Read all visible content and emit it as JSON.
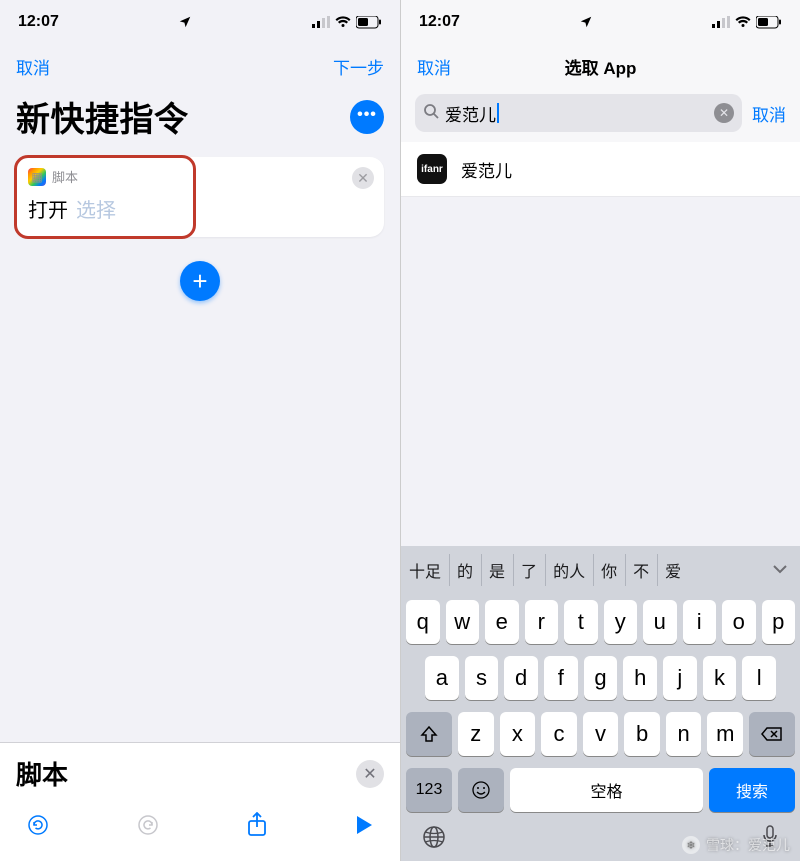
{
  "status": {
    "time": "12:07"
  },
  "left": {
    "nav": {
      "cancel": "取消",
      "next": "下一步"
    },
    "title": "新快捷指令",
    "action_card": {
      "category": "脚本",
      "verb": "打开",
      "param_placeholder": "选择"
    },
    "bottom": {
      "title": "脚本"
    }
  },
  "right": {
    "nav": {
      "cancel": "取消",
      "title": "选取 App"
    },
    "search": {
      "query": "爱范儿",
      "cancel": "取消"
    },
    "results": [
      {
        "name": "爱范儿",
        "icon_text": "ifanr"
      }
    ],
    "suggestions": [
      "十足",
      "的",
      "是",
      "了",
      "的人",
      "你",
      "不",
      "爱"
    ],
    "keyboard": {
      "row1": [
        "q",
        "w",
        "e",
        "r",
        "t",
        "y",
        "u",
        "i",
        "o",
        "p"
      ],
      "row2": [
        "a",
        "s",
        "d",
        "f",
        "g",
        "h",
        "j",
        "k",
        "l"
      ],
      "row3": [
        "z",
        "x",
        "c",
        "v",
        "b",
        "n",
        "m"
      ],
      "num_key": "123",
      "space": "空格",
      "search": "搜索"
    }
  },
  "watermark": "雪球：爱范儿"
}
